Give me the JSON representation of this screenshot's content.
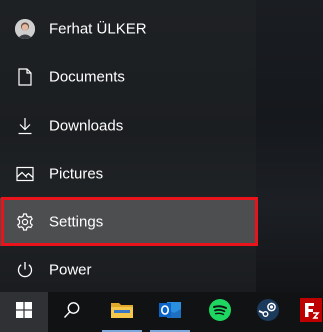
{
  "start_menu": {
    "user": {
      "name": "Ferhat ÜLKER",
      "icon": "user-avatar"
    },
    "items": [
      {
        "label": "Documents",
        "icon": "document-icon"
      },
      {
        "label": "Downloads",
        "icon": "download-icon"
      },
      {
        "label": "Pictures",
        "icon": "picture-icon"
      },
      {
        "label": "Settings",
        "icon": "gear-icon",
        "highlighted": true
      },
      {
        "label": "Power",
        "icon": "power-icon"
      }
    ]
  },
  "taskbar": {
    "apps": [
      {
        "name": "start",
        "icon": "windows-logo-icon"
      },
      {
        "name": "search",
        "icon": "search-icon"
      },
      {
        "name": "file-explorer",
        "icon": "folder-icon"
      },
      {
        "name": "outlook",
        "icon": "outlook-icon"
      },
      {
        "name": "spotify",
        "icon": "spotify-icon"
      },
      {
        "name": "steam",
        "icon": "steam-icon"
      },
      {
        "name": "filezilla",
        "icon": "filezilla-icon"
      }
    ]
  },
  "colors": {
    "highlight_border": "#e8131b",
    "selected_bg": "#4d4e50",
    "spotify_green": "#1ed760",
    "outlook_blue": "#0a64c8",
    "filezilla_red": "#bf0000",
    "explorer_yellow": "#f0c040"
  }
}
